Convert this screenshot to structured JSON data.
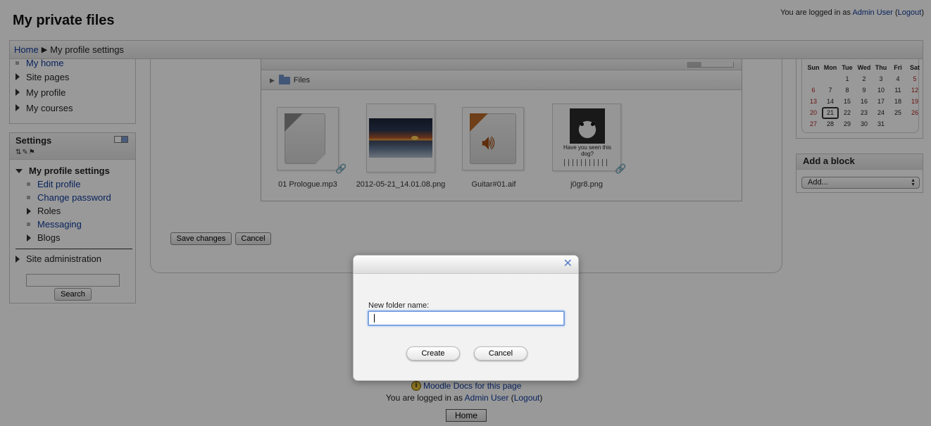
{
  "header": {
    "title": "My private files",
    "login_prefix": "You are logged in as ",
    "user": "Admin User",
    "logout": "Logout"
  },
  "breadcrumb": {
    "home": "Home",
    "current": "My profile settings"
  },
  "navigation": {
    "items": [
      {
        "label": "My home"
      },
      {
        "label": "Site pages"
      },
      {
        "label": "My profile"
      },
      {
        "label": "My courses"
      }
    ]
  },
  "settings": {
    "title": "Settings",
    "section": "My profile settings",
    "items": [
      "Edit profile",
      "Change password",
      "Roles",
      "Messaging",
      "Blogs"
    ],
    "site_admin": "Site administration",
    "search_button": "Search"
  },
  "filemanager": {
    "folder": "Files",
    "files": [
      {
        "name": "01 Prologue.mp3"
      },
      {
        "name": "2012-05-21_14.01.08.png"
      },
      {
        "name": "Guitar#01.aif"
      },
      {
        "name": "j0gr8.png"
      }
    ],
    "dog_caption": "Have you seen this dog?"
  },
  "form": {
    "save": "Save changes",
    "cancel": "Cancel"
  },
  "calendar": {
    "days": [
      "Sun",
      "Mon",
      "Tue",
      "Wed",
      "Thu",
      "Fri",
      "Sat"
    ],
    "dates": [
      [
        "",
        "",
        "1",
        "2",
        "3",
        "4",
        "5"
      ],
      [
        "6",
        "7",
        "8",
        "9",
        "10",
        "11",
        "12"
      ],
      [
        "13",
        "14",
        "15",
        "16",
        "17",
        "18",
        "19"
      ],
      [
        "20",
        "21",
        "22",
        "23",
        "24",
        "25",
        "26"
      ],
      [
        "27",
        "28",
        "29",
        "30",
        "31",
        "",
        ""
      ]
    ],
    "today": "21"
  },
  "add_block": {
    "title": "Add a block",
    "select": "Add..."
  },
  "footer": {
    "docs": "Moodle Docs for this page",
    "login_prefix": "You are logged in as ",
    "user": "Admin User",
    "logout": "Logout",
    "home": "Home"
  },
  "dialog": {
    "label": "New folder name:",
    "value": "",
    "create": "Create",
    "cancel": "Cancel"
  },
  "colors": {
    "link": "#0e3a9a",
    "weekend": "#b02020",
    "overlay": "rgba(0,0,0,0.4)"
  }
}
